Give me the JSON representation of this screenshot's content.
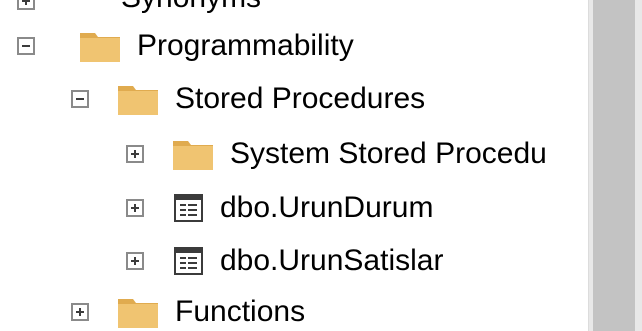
{
  "tree": {
    "cut_off_row": {
      "label": "Synonyms",
      "expanded": false
    },
    "items": [
      {
        "label": "Programmability",
        "icon": "folder-icon",
        "expanded": true,
        "level": 0
      },
      {
        "label": "Stored Procedures",
        "icon": "folder-icon",
        "expanded": true,
        "level": 1
      },
      {
        "label": "System Stored Procedu",
        "icon": "folder-icon",
        "expanded": false,
        "level": 2
      },
      {
        "label": "dbo.UrunDurum",
        "icon": "stored-procedure-icon",
        "expanded": false,
        "level": 2
      },
      {
        "label": "dbo.UrunSatislar",
        "icon": "stored-procedure-icon",
        "expanded": false,
        "level": 2
      },
      {
        "label": "Functions",
        "icon": "folder-icon",
        "expanded": false,
        "level": 1
      }
    ]
  },
  "colors": {
    "folder_body": "#f0c471",
    "folder_tab": "#e0ab4f",
    "scrollbar_track": "#e8e8e8",
    "scrollbar_thumb": "#c3c3c3",
    "expander_border": "#8a8a8a"
  }
}
